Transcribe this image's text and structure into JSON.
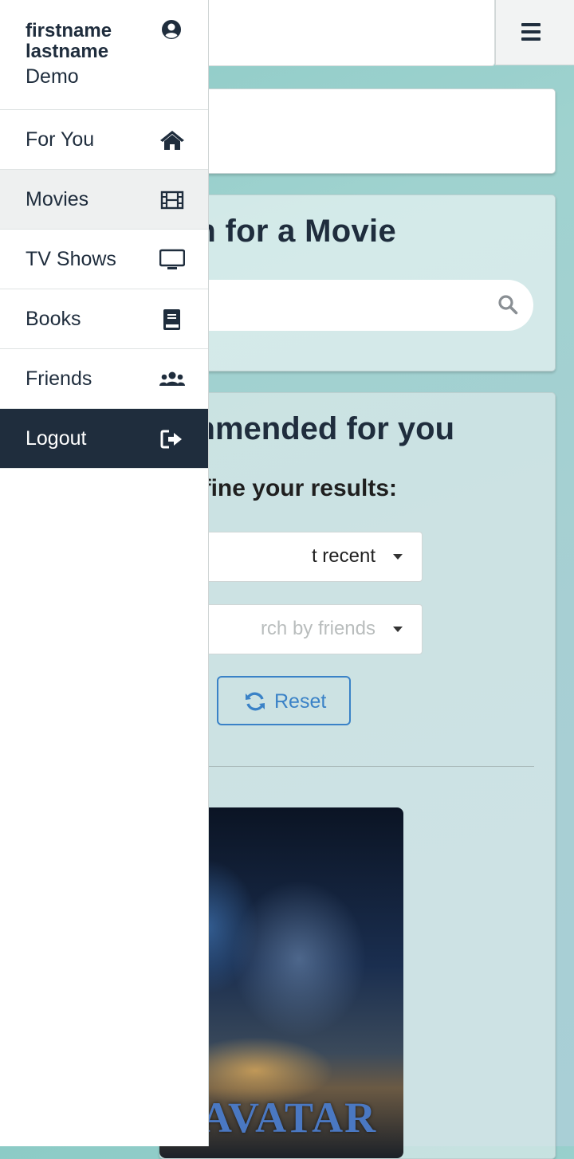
{
  "user": {
    "first_name": "firstname",
    "last_name": "lastname",
    "role": "Demo"
  },
  "nav": [
    {
      "label": "For You",
      "icon": "home-icon"
    },
    {
      "label": "Movies",
      "icon": "film-icon",
      "active": true
    },
    {
      "label": "TV Shows",
      "icon": "tv-icon"
    },
    {
      "label": "Books",
      "icon": "book-icon"
    },
    {
      "label": "Friends",
      "icon": "users-icon"
    },
    {
      "label": "Logout",
      "icon": "logout-icon"
    }
  ],
  "search": {
    "heading_visible": "n for a Movie"
  },
  "recommended": {
    "heading_visible": "nmended for you",
    "refine_visible": "fine your results:",
    "sort_value_visible": "t recent",
    "friends_placeholder_visible": "rch by friends",
    "reset_label": "Reset"
  },
  "poster": {
    "title": "AVATAR"
  },
  "colors": {
    "accent": "#3a82c7",
    "dark": "#1f2d3d"
  }
}
